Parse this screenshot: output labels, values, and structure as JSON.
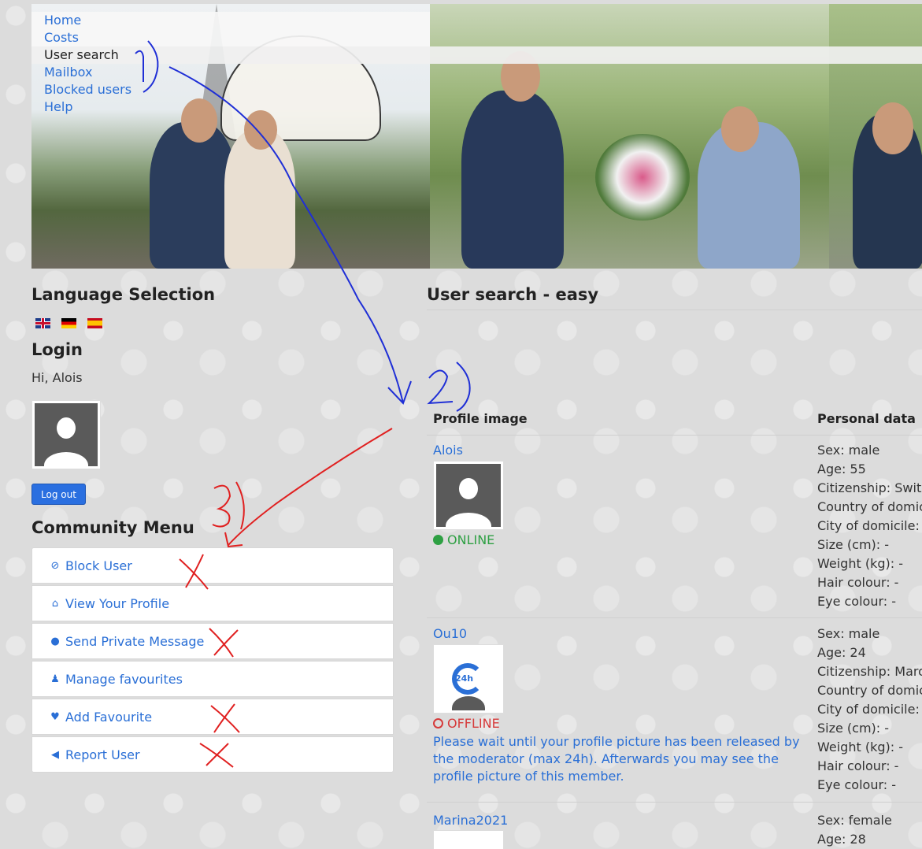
{
  "nav": {
    "items": [
      {
        "label": "Home",
        "active": false
      },
      {
        "label": "Costs",
        "active": false
      },
      {
        "label": "User search",
        "active": true
      },
      {
        "label": "Mailbox",
        "active": false
      },
      {
        "label": "Blocked users",
        "active": false
      },
      {
        "label": "Help",
        "active": false
      }
    ]
  },
  "language": {
    "title": "Language Selection",
    "flags": [
      "flag-uk-icon",
      "flag-de-icon",
      "flag-es-icon"
    ]
  },
  "login": {
    "title": "Login",
    "greeting": "Hi, Alois",
    "logout_label": "Log out"
  },
  "community": {
    "title": "Community Menu",
    "items": [
      {
        "label": "Block User",
        "icon": "ban-icon",
        "glyph": "⊘"
      },
      {
        "label": "View Your Profile",
        "icon": "home-icon",
        "glyph": "⌂"
      },
      {
        "label": "Send Private Message",
        "icon": "chat-icon",
        "glyph": "●"
      },
      {
        "label": "Manage favourites",
        "icon": "users-icon",
        "glyph": "♟"
      },
      {
        "label": "Add Favourite",
        "icon": "heart-icon",
        "glyph": "♥"
      },
      {
        "label": "Report User",
        "icon": "bullhorn-icon",
        "glyph": "◀"
      }
    ]
  },
  "search": {
    "title": "User search - easy",
    "columns": {
      "image": "Profile image",
      "data": "Personal data"
    },
    "members": [
      {
        "name": "Alois",
        "status": "ONLINE",
        "notice": "",
        "data": [
          "Sex: male",
          "Age: 55",
          "Citizenship: Switzerland",
          "Country of domicile: -",
          "City of domicile: -",
          "Size (cm): -",
          "Weight (kg): -",
          "Hair colour: -",
          "Eye colour: -"
        ]
      },
      {
        "name": "Ou10",
        "status": "OFFLINE",
        "notice": "Please wait until your profile picture has been released by the moderator (max 24h). Afterwards you may see the profile picture of this member.",
        "pending_label": "24h",
        "data": [
          "Sex: male",
          "Age: 24",
          "Citizenship: Maroc",
          "Country of domicile: -",
          "City of domicile: -",
          "Size (cm): -",
          "Weight (kg): -",
          "Hair colour: -",
          "Eye colour: -"
        ]
      },
      {
        "name": "Marina2021",
        "status": "",
        "notice": "",
        "data": [
          "Sex: female",
          "Age: 28"
        ]
      }
    ]
  },
  "annotations": {
    "blue_color": "#1f2fd6",
    "red_color": "#e02020",
    "label_1": "1)",
    "label_2": "2)",
    "label_3": "3)"
  }
}
